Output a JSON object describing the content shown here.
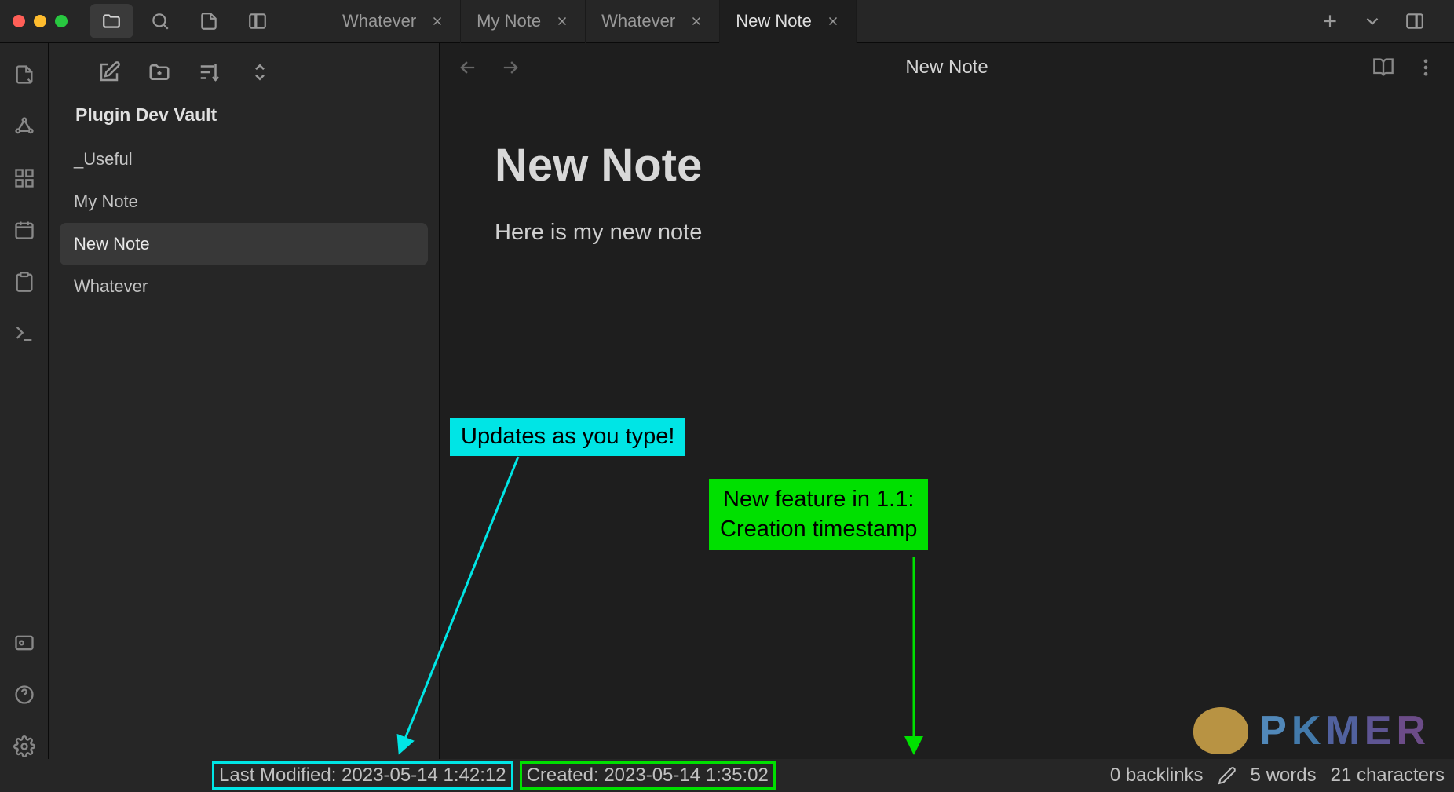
{
  "tabs": [
    {
      "label": "Whatever",
      "active": false
    },
    {
      "label": "My Note",
      "active": false
    },
    {
      "label": "Whatever",
      "active": false
    },
    {
      "label": "New Note",
      "active": true
    }
  ],
  "sidebar": {
    "vault_name": "Plugin Dev Vault",
    "files": [
      {
        "name": "_Useful",
        "active": false
      },
      {
        "name": "My Note",
        "active": false
      },
      {
        "name": "New Note",
        "active": true
      },
      {
        "name": "Whatever",
        "active": false
      }
    ]
  },
  "editor": {
    "header_title": "New Note",
    "note_title": "New Note",
    "note_body": "Here is my new note"
  },
  "statusbar": {
    "last_modified": "Last Modified: 2023-05-14 1:42:12",
    "created": "Created: 2023-05-14 1:35:02",
    "backlinks": "0 backlinks",
    "words": "5 words",
    "characters": "21 characters"
  },
  "annotations": {
    "cyan": "Updates as you type!",
    "green_line1": "New feature in 1.1:",
    "green_line2": "Creation timestamp"
  },
  "watermark": "PKMER"
}
